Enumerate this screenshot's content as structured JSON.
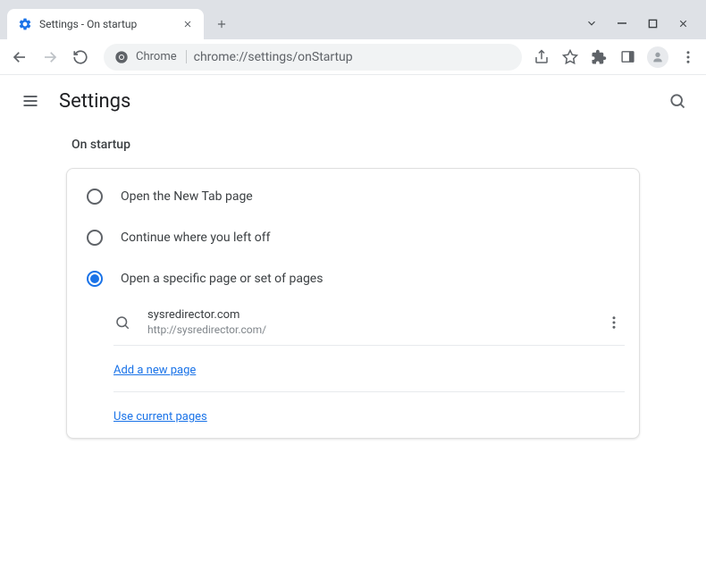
{
  "window": {
    "tab_title": "Settings - On startup"
  },
  "omnibox": {
    "label": "Chrome",
    "url": "chrome://settings/onStartup"
  },
  "header": {
    "title": "Settings"
  },
  "content": {
    "section_title": "On startup",
    "options": [
      {
        "label": "Open the New Tab page",
        "selected": false
      },
      {
        "label": "Continue where you left off",
        "selected": false
      },
      {
        "label": "Open a specific page or set of pages",
        "selected": true
      }
    ],
    "pages": [
      {
        "title": "sysredirector.com",
        "url": "http://sysredirector.com/"
      }
    ],
    "add_page_label": "Add a new page",
    "use_current_label": "Use current pages"
  }
}
